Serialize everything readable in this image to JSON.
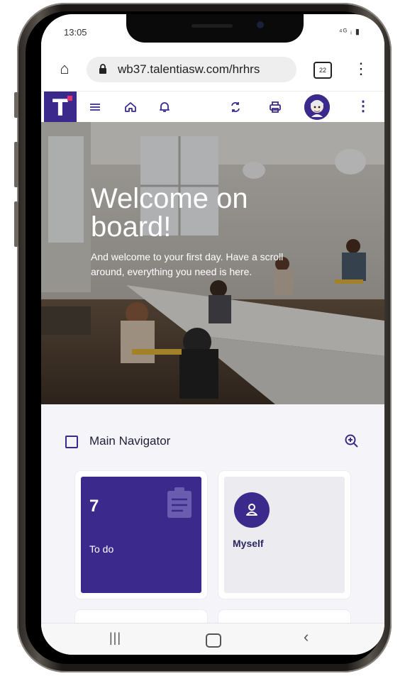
{
  "status_bar": {
    "time": "13:05",
    "icons": "⁴ᴳ ᵢ ▮"
  },
  "browser": {
    "url": "wb37.talentiasw.com/hrhrs",
    "tab_count": "22"
  },
  "app": {
    "brand_letter": "T"
  },
  "hero": {
    "title": "Welcome on board!",
    "subtitle": "And welcome to your first day. Have a scroll around, everything you need is here."
  },
  "navigator": {
    "title": "Main Navigator",
    "cards": [
      {
        "count": "7",
        "label": "To do"
      },
      {
        "label": "Myself"
      }
    ]
  },
  "colors": {
    "brand": "#3b2a8c",
    "accent": "#e6336f"
  }
}
